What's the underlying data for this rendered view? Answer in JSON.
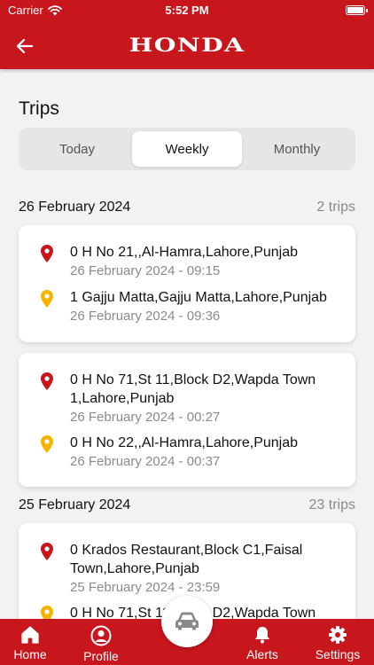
{
  "status_bar": {
    "carrier": "Carrier",
    "time": "5:52 PM"
  },
  "app_bar": {
    "brand": "HONDA"
  },
  "page": {
    "title": "Trips"
  },
  "period_tabs": [
    {
      "label": "Today",
      "active": false
    },
    {
      "label": "Weekly",
      "active": true
    },
    {
      "label": "Monthly",
      "active": false
    }
  ],
  "days": [
    {
      "date": "26 February 2024",
      "count": "2 trips",
      "trips": [
        {
          "start": {
            "address": "0 H No 21,,Al-Hamra,Lahore,Punjab",
            "time": "26 February 2024 - 09:15"
          },
          "end": {
            "address": "1 Gajju Matta,Gajju Matta,Lahore,Punjab",
            "time": "26 February 2024 - 09:36"
          }
        },
        {
          "start": {
            "address": "0 H No 71,St 11,Block D2,Wapda Town 1,Lahore,Punjab",
            "time": "26 February 2024 - 00:27"
          },
          "end": {
            "address": "0 H No 22,,Al-Hamra,Lahore,Punjab",
            "time": "26 February 2024 - 00:37"
          }
        }
      ]
    },
    {
      "date": "25 February 2024",
      "count": "23 trips",
      "trips": [
        {
          "start": {
            "address": "0 Krados Restaurant,Block C1,Faisal Town,Lahore,Punjab",
            "time": "25 February 2024 - 23:59"
          },
          "end": {
            "address": "0 H No 71,St 11,Block D2,Wapda Town",
            "time": ""
          }
        }
      ]
    }
  ],
  "tab_bar": {
    "home": "Home",
    "profile": "Profile",
    "alerts": "Alerts",
    "settings": "Settings"
  },
  "colors": {
    "primary": "#c8161d",
    "start_pin": "#c8161d",
    "end_pin": "#f4b400",
    "background": "#f2f2f2"
  },
  "icons": {
    "back": "arrow-left-icon",
    "start": "map-pin-icon",
    "end": "map-pin-icon",
    "home": "home-icon",
    "profile": "user-circle-icon",
    "center": "car-icon",
    "alerts": "bell-icon",
    "settings": "gear-icon"
  }
}
